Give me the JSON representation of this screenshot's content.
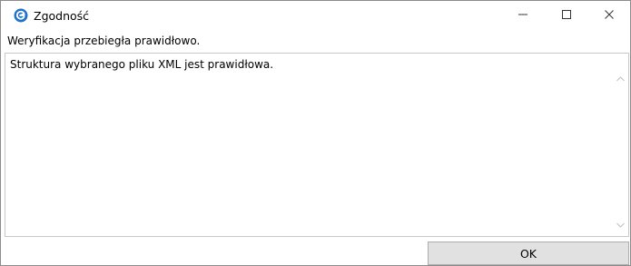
{
  "window": {
    "title": "Zgodność",
    "icon": "app-logo-icon",
    "controls": {
      "minimize_icon": "minimize-icon",
      "maximize_icon": "maximize-icon",
      "close_icon": "close-icon"
    },
    "accent_color": "#1e73c8"
  },
  "main": {
    "message": "Weryfikacja przebiegła prawidłowo.",
    "details": "Struktura wybranego pliku XML jest prawidłowa."
  },
  "footer": {
    "ok_label": "OK"
  }
}
